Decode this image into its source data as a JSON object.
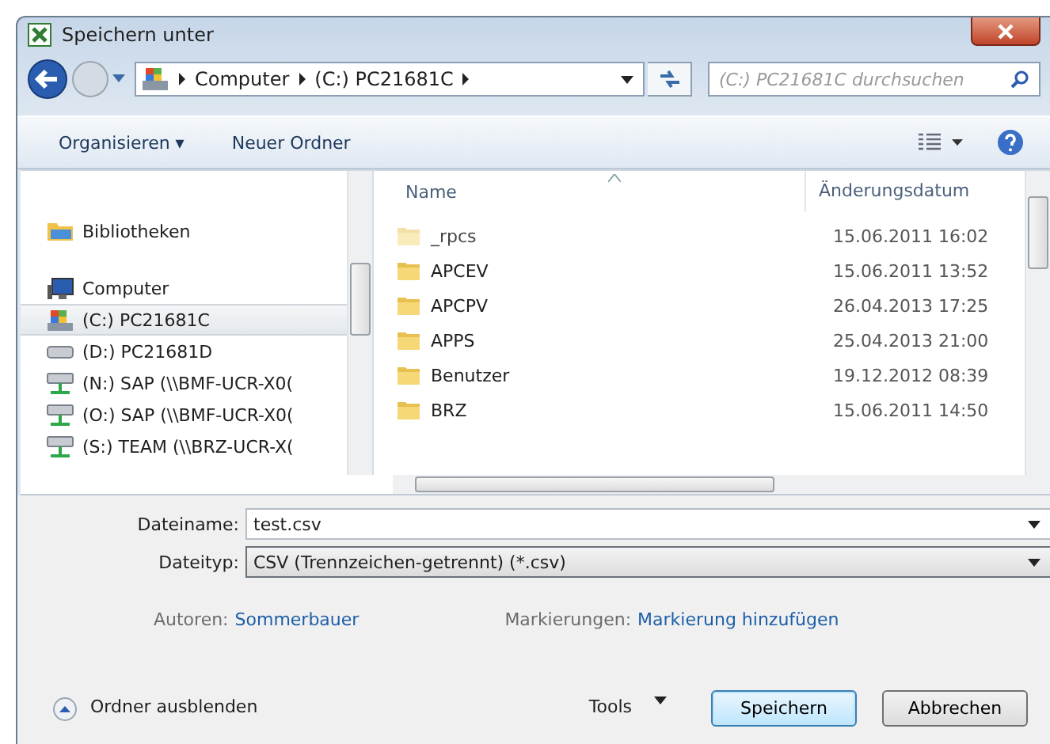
{
  "window": {
    "title": "Speichern unter"
  },
  "address": {
    "crumbs": [
      "Computer",
      "(C:) PC21681C"
    ]
  },
  "search": {
    "placeholder": "(C:) PC21681C durchsuchen"
  },
  "toolbar": {
    "organize": "Organisieren ▾",
    "new_folder": "Neuer Ordner"
  },
  "sidebar": {
    "groups": [
      {
        "items": [
          {
            "kind": "library",
            "label": "Bibliotheken",
            "selected": false
          }
        ]
      },
      {
        "items": [
          {
            "kind": "computer",
            "label": "Computer",
            "selected": false
          },
          {
            "kind": "system",
            "label": "(C:) PC21681C",
            "selected": true
          },
          {
            "kind": "disk",
            "label": "(D:) PC21681D",
            "selected": false
          },
          {
            "kind": "network",
            "label": "(N:) SAP (\\\\BMF-UCR-X0(",
            "selected": false
          },
          {
            "kind": "network",
            "label": "(O:) SAP (\\\\BMF-UCR-X0(",
            "selected": false
          },
          {
            "kind": "network",
            "label": "(S:) TEAM (\\\\BRZ-UCR-X(",
            "selected": false
          }
        ]
      }
    ]
  },
  "table": {
    "columns": [
      "Name",
      "Änderungsdatum"
    ],
    "rows": [
      {
        "name": "_rpcs",
        "date": "15.06.2011 16:02",
        "hidden": true
      },
      {
        "name": "APCEV",
        "date": "15.06.2011 13:52",
        "hidden": false
      },
      {
        "name": "APCPV",
        "date": "26.04.2013 17:25",
        "hidden": false
      },
      {
        "name": "APPS",
        "date": "25.04.2013 21:00",
        "hidden": false
      },
      {
        "name": "Benutzer",
        "date": "19.12.2012 08:39",
        "hidden": false
      },
      {
        "name": "BRZ",
        "date": "15.06.2011 14:50",
        "hidden": false
      }
    ]
  },
  "filename": {
    "label": "Dateiname:",
    "value": "test.csv"
  },
  "filetype": {
    "label": "Dateityp:",
    "value": "CSV (Trennzeichen-getrennt) (*.csv)"
  },
  "meta": {
    "authors_label": "Autoren:",
    "authors": "Sommerbauer",
    "tags_label": "Markierungen:",
    "tags": "Markierung hinzufügen"
  },
  "footer": {
    "hide_folders": "Ordner ausblenden",
    "tools": "Tools",
    "save": "Speichern",
    "cancel": "Abbrechen"
  }
}
